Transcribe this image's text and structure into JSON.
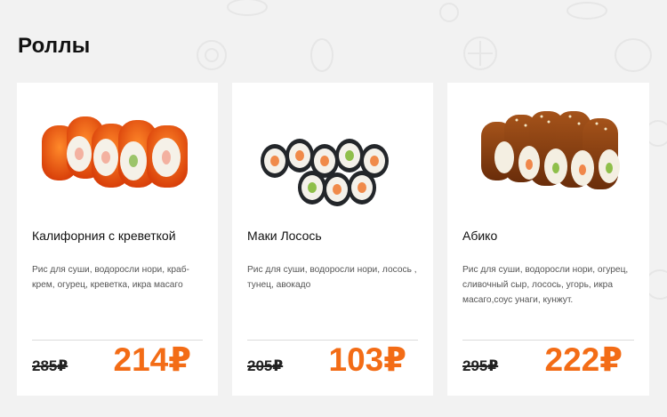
{
  "section": {
    "title": "Роллы"
  },
  "colors": {
    "accent": "#f36c16",
    "background": "#f2f2f2",
    "card": "#ffffff"
  },
  "products": [
    {
      "name": "Калифорния с креветкой",
      "description": "Рис для суши, водоросли нори, краб-крем, огурец, креветка, икра масаго",
      "old_price": "285₽",
      "price": "214₽",
      "image": "california-roll-photo"
    },
    {
      "name": "Маки Лосось",
      "description": "Рис для суши, водоросли нори, лосось , тунец, авокадо",
      "old_price": "205₽",
      "price": "103₽",
      "image": "maki-salmon-photo"
    },
    {
      "name": "Абико",
      "description": "Рис для суши, водоросли нори, огурец, сливочный сыр, лосось, угорь, икра масаго,соус унаги, кунжут.",
      "old_price": "295₽",
      "price": "222₽",
      "image": "abiko-roll-photo"
    }
  ]
}
